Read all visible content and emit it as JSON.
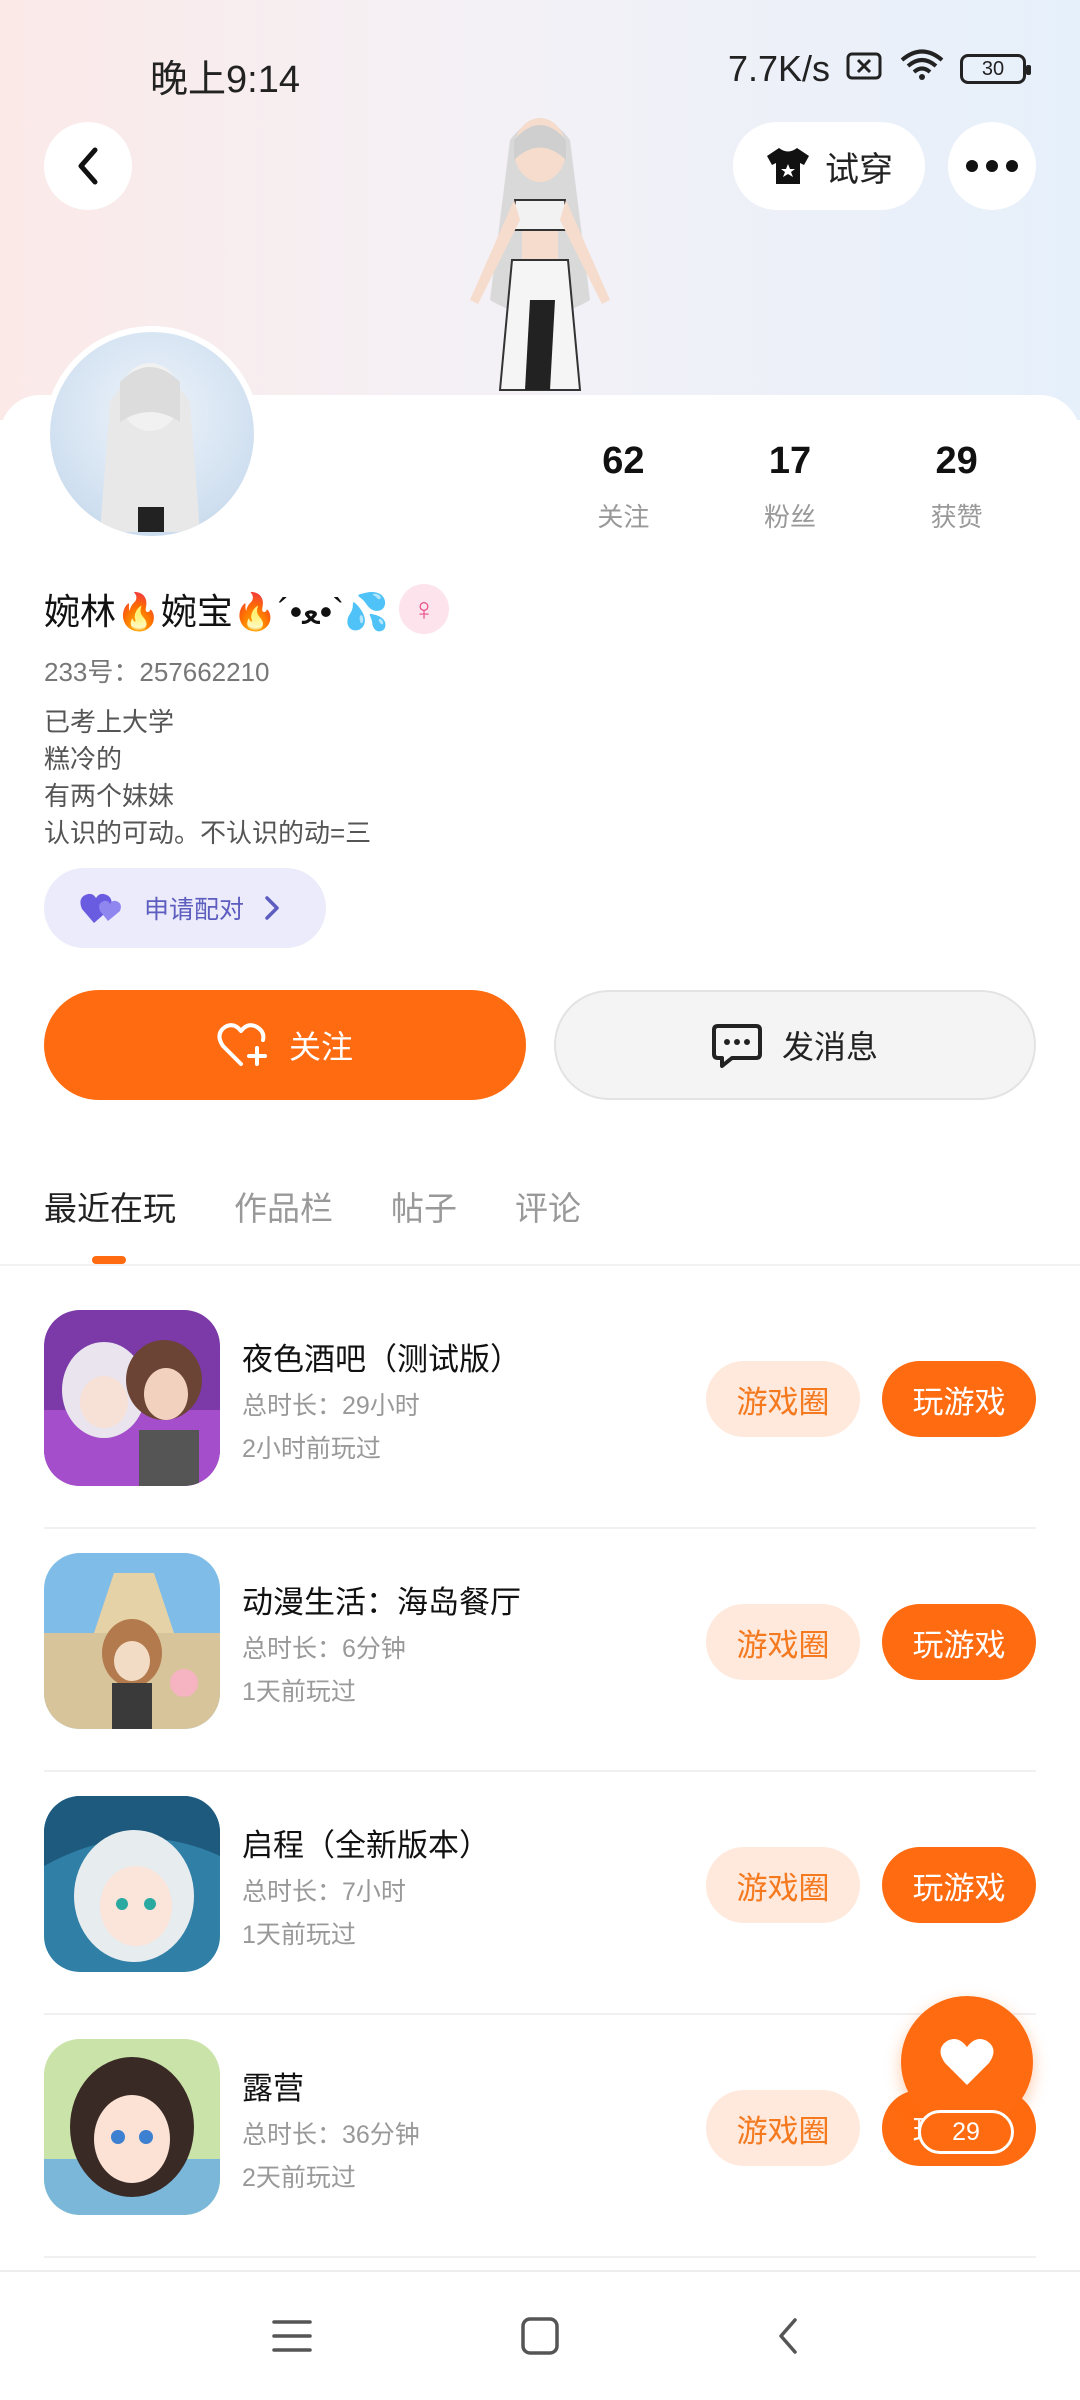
{
  "status_bar": {
    "time": "晚上9:14",
    "network_speed": "7.7K/s",
    "battery": "30"
  },
  "header": {
    "try_on_label": "试穿"
  },
  "profile": {
    "stats": [
      {
        "value": "62",
        "label": "关注"
      },
      {
        "value": "17",
        "label": "粉丝"
      },
      {
        "value": "29",
        "label": "获赞"
      }
    ],
    "nickname": "婉林🔥婉宝🔥´•ﻌ•`💦",
    "gender_symbol": "♀",
    "uid": "233号：257662210",
    "bio": [
      "已考上大学",
      "糕冷的",
      "有两个妹妹",
      "认识的可动。不认识的动=三"
    ],
    "match_label": "申请配对",
    "follow_label": "关注",
    "message_label": "发消息"
  },
  "tabs": [
    "最近在玩",
    "作品栏",
    "帖子",
    "评论"
  ],
  "games": [
    {
      "title": "夜色酒吧（测试版）",
      "duration": "总时长：29小时",
      "last_played": "2小时前玩过",
      "circle_label": "游戏圈",
      "play_label": "玩游戏"
    },
    {
      "title": "动漫生活：海岛餐厅",
      "duration": "总时长：6分钟",
      "last_played": "1天前玩过",
      "circle_label": "游戏圈",
      "play_label": "玩游戏"
    },
    {
      "title": "启程（全新版本）",
      "duration": "总时长：7小时",
      "last_played": "1天前玩过",
      "circle_label": "游戏圈",
      "play_label": "玩游戏"
    },
    {
      "title": "露营",
      "duration": "总时长：36分钟",
      "last_played": "2天前玩过",
      "circle_label": "游戏圈",
      "play_label": "玩游戏"
    }
  ],
  "like_fab": {
    "count": "29"
  },
  "colors": {
    "accent": "#ff6b10",
    "accent_soft": "#ffe9dc",
    "match_bg": "#ebebfb"
  }
}
